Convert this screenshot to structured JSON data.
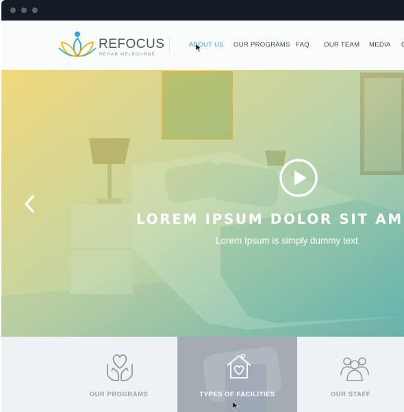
{
  "brand": {
    "name": "REFOCUS",
    "tagline": "REHAB MELBOURNE",
    "logo_icon": "lotus-person-icon"
  },
  "nav": {
    "items": [
      {
        "label": "ABOUT US",
        "active": true
      },
      {
        "label": "OUR PROGRAMS",
        "active": false
      },
      {
        "label": "FAQ",
        "active": false
      },
      {
        "label": "OUR TEAM",
        "active": false
      },
      {
        "label": "MEDIA",
        "active": false
      },
      {
        "label": "C",
        "active": false
      }
    ]
  },
  "hero": {
    "title": "LOREM IPSUM DOLOR SIT AMET",
    "subtitle": "Lorem Ipsum is simply dummy text",
    "play_icon": "play-icon",
    "prev_icon": "chevron-left-icon",
    "gradient_start": "#f2cf4a",
    "gradient_end": "#2a9c9a"
  },
  "tiles": [
    {
      "label": "OUR PROGRAMS",
      "icon": "heart-hands-icon",
      "active": false
    },
    {
      "label": "TYPES OF FACILITIES",
      "icon": "heart-home-icon",
      "active": true
    },
    {
      "label": "OUR STAFF",
      "icon": "people-group-icon",
      "active": false
    }
  ],
  "colors": {
    "accent": "#2fa7d8",
    "chrome": "#151c25",
    "text": "#3a4652"
  }
}
